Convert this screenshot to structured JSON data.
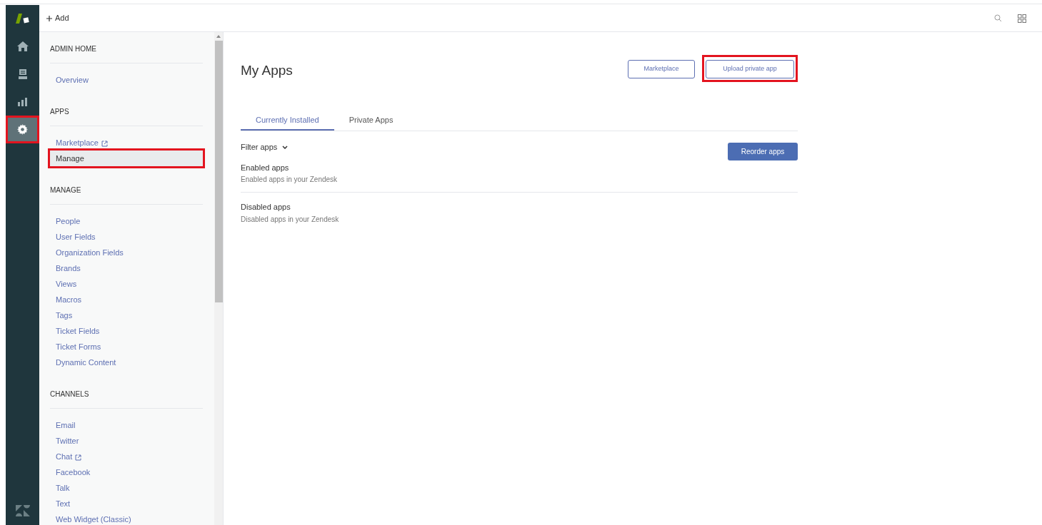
{
  "nav_rail": [
    {
      "kind": "home",
      "selected": false,
      "highlighted": false
    },
    {
      "kind": "tickets",
      "selected": false,
      "highlighted": false
    },
    {
      "kind": "reporting",
      "selected": false,
      "highlighted": false
    },
    {
      "kind": "settings",
      "selected": true,
      "highlighted": true
    }
  ],
  "top_bar": {
    "add_label": "Add"
  },
  "sidebar": {
    "sections": [
      {
        "title": "ADMIN HOME",
        "items": [
          {
            "label": "Overview",
            "external": false,
            "selected": false,
            "highlighted": false
          }
        ]
      },
      {
        "title": "APPS",
        "items": [
          {
            "label": "Marketplace",
            "external": true,
            "selected": false,
            "highlighted": false
          },
          {
            "label": "Manage",
            "external": false,
            "selected": true,
            "highlighted": true
          }
        ]
      },
      {
        "title": "MANAGE",
        "items": [
          {
            "label": "People",
            "external": false,
            "selected": false,
            "highlighted": false
          },
          {
            "label": "User Fields",
            "external": false,
            "selected": false,
            "highlighted": false
          },
          {
            "label": "Organization Fields",
            "external": false,
            "selected": false,
            "highlighted": false
          },
          {
            "label": "Brands",
            "external": false,
            "selected": false,
            "highlighted": false
          },
          {
            "label": "Views",
            "external": false,
            "selected": false,
            "highlighted": false
          },
          {
            "label": "Macros",
            "external": false,
            "selected": false,
            "highlighted": false
          },
          {
            "label": "Tags",
            "external": false,
            "selected": false,
            "highlighted": false
          },
          {
            "label": "Ticket Fields",
            "external": false,
            "selected": false,
            "highlighted": false
          },
          {
            "label": "Ticket Forms",
            "external": false,
            "selected": false,
            "highlighted": false
          },
          {
            "label": "Dynamic Content",
            "external": false,
            "selected": false,
            "highlighted": false
          }
        ]
      },
      {
        "title": "CHANNELS",
        "items": [
          {
            "label": "Email",
            "external": false,
            "selected": false,
            "highlighted": false
          },
          {
            "label": "Twitter",
            "external": false,
            "selected": false,
            "highlighted": false
          },
          {
            "label": "Chat",
            "external": true,
            "selected": false,
            "highlighted": false
          },
          {
            "label": "Facebook",
            "external": false,
            "selected": false,
            "highlighted": false
          },
          {
            "label": "Talk",
            "external": false,
            "selected": false,
            "highlighted": false
          },
          {
            "label": "Text",
            "external": false,
            "selected": false,
            "highlighted": false
          },
          {
            "label": "Web Widget (Classic)",
            "external": false,
            "selected": false,
            "highlighted": false
          }
        ]
      }
    ]
  },
  "page": {
    "title": "My Apps",
    "buttons": [
      {
        "label": "Marketplace",
        "highlighted": false
      },
      {
        "label": "Upload private app",
        "highlighted": true
      }
    ],
    "tabs": [
      {
        "label": "Currently Installed",
        "selected": true
      },
      {
        "label": "Private Apps",
        "selected": false
      }
    ],
    "filter": {
      "label": "Filter apps"
    },
    "reorder_button": "Reorder apps",
    "groups": [
      {
        "title": "Enabled apps",
        "subtitle": "Enabled apps in your Zendesk"
      },
      {
        "title": "Disabled apps",
        "subtitle": "Disabled apps in your Zendesk"
      }
    ]
  }
}
